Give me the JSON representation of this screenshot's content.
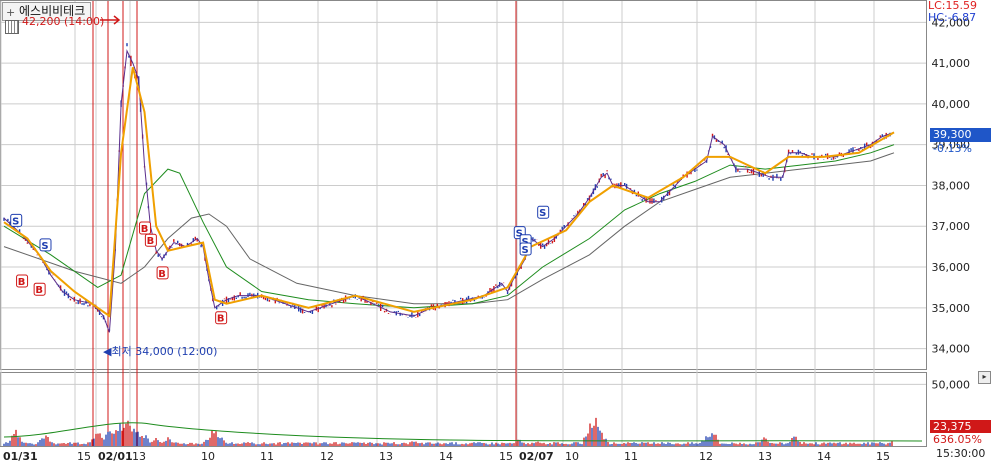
{
  "stock_name": "에스비비테크",
  "lc_label": "LC:15.59",
  "hc_label": "HC:-6.87",
  "high_annotation": "42,200 (14:00)",
  "low_annotation": "최저 34,000 (12:00)",
  "current_price_label": "39,300",
  "change_label": "-0.13%",
  "volume_label": "23,375",
  "volume_pct_label": "636.05%",
  "time_end_label": "15:30:00",
  "colors": {
    "candle_up": "#d01818",
    "candle_down": "#1f3fb0",
    "ma_short": "#f0a000",
    "ma_mid": "#1e8c1e",
    "ma_long": "#666666",
    "marker_line": "#d01818",
    "grid": "#cccccc"
  },
  "chart_data": [
    {
      "type": "candlestick",
      "ylim": [
        33500,
        42400
      ],
      "y_ticks": [
        "34,000",
        "35,000",
        "36,000",
        "37,000",
        "38,000",
        "39,000",
        "40,000",
        "41,000",
        "42,000"
      ],
      "x_labels": [
        "01/31",
        "15",
        "02/01",
        "13",
        "10",
        "11",
        "12",
        "13",
        "14",
        "15",
        "02/07",
        "10",
        "11",
        "12",
        "13",
        "14",
        "15"
      ],
      "price_path": [
        [
          0,
          37200
        ],
        [
          3,
          36800
        ],
        [
          6,
          36300
        ],
        [
          8,
          35800
        ],
        [
          10,
          35400
        ],
        [
          12,
          35200
        ],
        [
          15,
          35100
        ],
        [
          17,
          34800
        ],
        [
          18,
          34400
        ],
        [
          19,
          36400
        ],
        [
          20,
          40000
        ],
        [
          21,
          41300
        ],
        [
          22,
          41000
        ],
        [
          23,
          40600
        ],
        [
          24,
          38500
        ],
        [
          25,
          37000
        ],
        [
          26,
          36400
        ],
        [
          27,
          36200
        ],
        [
          29,
          36600
        ],
        [
          31,
          36500
        ],
        [
          33,
          36700
        ],
        [
          34,
          36500
        ],
        [
          35,
          35700
        ],
        [
          36,
          35000
        ],
        [
          37,
          35100
        ],
        [
          38,
          35200
        ],
        [
          40,
          35300
        ],
        [
          44,
          35300
        ],
        [
          48,
          35100
        ],
        [
          52,
          34900
        ],
        [
          56,
          35100
        ],
        [
          60,
          35300
        ],
        [
          63,
          35100
        ],
        [
          66,
          34900
        ],
        [
          70,
          34800
        ],
        [
          73,
          35000
        ],
        [
          76,
          35100
        ],
        [
          79,
          35200
        ],
        [
          82,
          35300
        ],
        [
          85,
          35600
        ],
        [
          86,
          35400
        ],
        [
          87,
          35700
        ],
        [
          89,
          36200
        ],
        [
          90,
          36700
        ],
        [
          92,
          36500
        ],
        [
          94,
          36700
        ],
        [
          96,
          37000
        ],
        [
          98,
          37300
        ],
        [
          100,
          37700
        ],
        [
          102,
          38200
        ],
        [
          103,
          38300
        ],
        [
          104,
          38000
        ],
        [
          106,
          38000
        ],
        [
          108,
          37800
        ],
        [
          110,
          37600
        ],
        [
          112,
          37600
        ],
        [
          114,
          37900
        ],
        [
          116,
          38200
        ],
        [
          118,
          38400
        ],
        [
          120,
          38600
        ],
        [
          121,
          39200
        ],
        [
          123,
          39000
        ],
        [
          125,
          38400
        ],
        [
          127,
          38400
        ],
        [
          129,
          38300
        ],
        [
          131,
          38200
        ],
        [
          133,
          38200
        ],
        [
          134,
          38800
        ],
        [
          136,
          38800
        ],
        [
          138,
          38700
        ],
        [
          140,
          38700
        ],
        [
          142,
          38700
        ],
        [
          144,
          38800
        ],
        [
          146,
          38900
        ],
        [
          148,
          39000
        ],
        [
          150,
          39200
        ],
        [
          152,
          39300
        ]
      ],
      "ma_short": [
        [
          0,
          37100
        ],
        [
          4,
          36700
        ],
        [
          8,
          35900
        ],
        [
          12,
          35400
        ],
        [
          16,
          35000
        ],
        [
          18,
          34800
        ],
        [
          20,
          38800
        ],
        [
          22,
          40900
        ],
        [
          24,
          39800
        ],
        [
          26,
          37000
        ],
        [
          28,
          36400
        ],
        [
          31,
          36500
        ],
        [
          34,
          36600
        ],
        [
          36,
          35200
        ],
        [
          38,
          35100
        ],
        [
          44,
          35300
        ],
        [
          52,
          35000
        ],
        [
          60,
          35300
        ],
        [
          70,
          34900
        ],
        [
          80,
          35200
        ],
        [
          86,
          35500
        ],
        [
          90,
          36500
        ],
        [
          96,
          36900
        ],
        [
          100,
          37600
        ],
        [
          104,
          38000
        ],
        [
          110,
          37700
        ],
        [
          116,
          38200
        ],
        [
          120,
          38700
        ],
        [
          124,
          38700
        ],
        [
          130,
          38300
        ],
        [
          134,
          38700
        ],
        [
          140,
          38700
        ],
        [
          146,
          38800
        ],
        [
          152,
          39300
        ]
      ],
      "ma_mid": [
        [
          0,
          37000
        ],
        [
          8,
          36300
        ],
        [
          16,
          35500
        ],
        [
          20,
          35800
        ],
        [
          24,
          37800
        ],
        [
          28,
          38400
        ],
        [
          30,
          38300
        ],
        [
          34,
          37100
        ],
        [
          38,
          36000
        ],
        [
          44,
          35400
        ],
        [
          52,
          35200
        ],
        [
          60,
          35100
        ],
        [
          70,
          35000
        ],
        [
          80,
          35100
        ],
        [
          86,
          35300
        ],
        [
          92,
          36000
        ],
        [
          100,
          36700
        ],
        [
          106,
          37400
        ],
        [
          112,
          37800
        ],
        [
          118,
          38100
        ],
        [
          124,
          38500
        ],
        [
          130,
          38400
        ],
        [
          136,
          38500
        ],
        [
          142,
          38600
        ],
        [
          148,
          38800
        ],
        [
          152,
          39000
        ]
      ],
      "ma_long": [
        [
          0,
          36500
        ],
        [
          12,
          35900
        ],
        [
          20,
          35600
        ],
        [
          24,
          36000
        ],
        [
          28,
          36700
        ],
        [
          32,
          37200
        ],
        [
          35,
          37300
        ],
        [
          38,
          37000
        ],
        [
          42,
          36200
        ],
        [
          50,
          35600
        ],
        [
          60,
          35300
        ],
        [
          70,
          35100
        ],
        [
          80,
          35100
        ],
        [
          86,
          35200
        ],
        [
          92,
          35700
        ],
        [
          100,
          36300
        ],
        [
          106,
          37000
        ],
        [
          112,
          37600
        ],
        [
          118,
          37900
        ],
        [
          124,
          38200
        ],
        [
          130,
          38300
        ],
        [
          136,
          38400
        ],
        [
          142,
          38500
        ],
        [
          148,
          38600
        ],
        [
          152,
          38800
        ]
      ],
      "buy_signals": [
        [
          3,
          36000
        ],
        [
          6,
          35800
        ],
        [
          24,
          37300
        ],
        [
          25,
          37000
        ],
        [
          27,
          36200
        ],
        [
          37,
          35100
        ]
      ],
      "sell_signals": [
        [
          2,
          36800
        ],
        [
          7,
          36200
        ],
        [
          88,
          36500
        ],
        [
          89,
          36300
        ],
        [
          89,
          36100
        ],
        [
          92,
          37000
        ]
      ]
    },
    {
      "type": "bar",
      "ylim": [
        0,
        60000
      ],
      "y_ticks": [
        "50,000"
      ],
      "volume_spikes": [
        [
          2,
          14000
        ],
        [
          7,
          11000
        ],
        [
          16,
          15000
        ],
        [
          18,
          20000
        ],
        [
          19,
          18000
        ],
        [
          20,
          22000
        ],
        [
          21,
          25000
        ],
        [
          22,
          19000
        ],
        [
          23,
          14000
        ],
        [
          24,
          11000
        ],
        [
          26,
          9000
        ],
        [
          28,
          8000
        ],
        [
          35,
          8000
        ],
        [
          36,
          18000
        ],
        [
          37,
          9000
        ],
        [
          50,
          4000
        ],
        [
          70,
          5000
        ],
        [
          88,
          6000
        ],
        [
          91,
          5000
        ],
        [
          100,
          20000
        ],
        [
          101,
          28000
        ],
        [
          102,
          12000
        ],
        [
          120,
          10000
        ],
        [
          121,
          15000
        ],
        [
          130,
          8000
        ],
        [
          135,
          9000
        ],
        [
          152,
          7000
        ]
      ]
    }
  ]
}
